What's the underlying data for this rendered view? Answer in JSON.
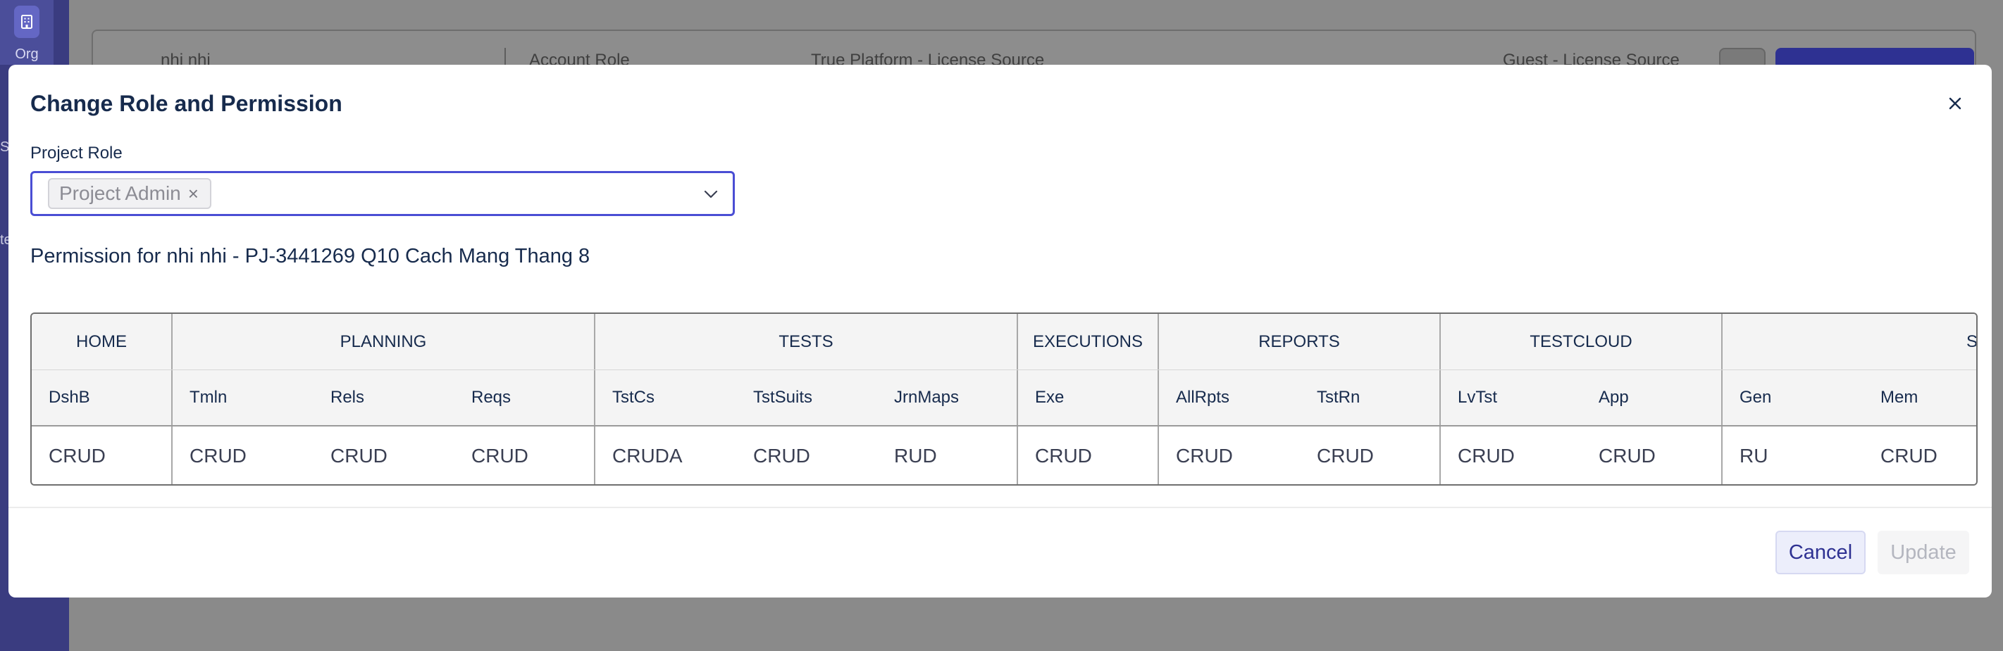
{
  "background": {
    "rail": {
      "org_label": "Org",
      "partial_1": "S",
      "partial_2": "te"
    },
    "card": {
      "user_name": "nhi nhi",
      "account_role_label": "Account Role",
      "platform_label": "True Platform - License Source",
      "guest_label": "Guest - License Source"
    }
  },
  "modal": {
    "title": "Change Role and Permission",
    "project_role_label": "Project Role",
    "selected_role": "Project Admin",
    "permission_title": "Permission for nhi nhi - PJ-3441269 Q10 Cach Mang Thang 8",
    "cancel_label": "Cancel",
    "update_label": "Update"
  },
  "table": {
    "groups": [
      "HOME",
      "PLANNING",
      "TESTS",
      "EXECUTIONS",
      "REPORTS",
      "TESTCLOUD",
      "S"
    ],
    "columns": [
      "DshB",
      "Tmln",
      "Rels",
      "Reqs",
      "TstCs",
      "TstSuits",
      "JrnMaps",
      "Exe",
      "AllRpts",
      "TstRn",
      "LvTst",
      "App",
      "Gen",
      "Mem"
    ],
    "values": [
      "CRUD",
      "CRUD",
      "CRUD",
      "CRUD",
      "CRUDA",
      "CRUD",
      "RUD",
      "CRUD",
      "CRUD",
      "CRUD",
      "CRUD",
      "CRUD",
      "RU",
      "CRUD"
    ]
  },
  "colors": {
    "accent": "#2e3192",
    "focus_border": "#4a4ed4",
    "rail": "#3a3c80"
  }
}
